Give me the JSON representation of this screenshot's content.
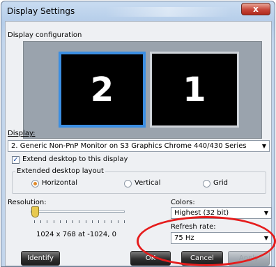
{
  "window": {
    "title": "Display Settings",
    "close_glyph": "x"
  },
  "config": {
    "section_label": "Display configuration",
    "monitors": [
      {
        "number": "2"
      },
      {
        "number": "1"
      }
    ]
  },
  "display": {
    "label": "Display:",
    "value": "2. Generic Non-PnP Monitor on S3 Graphics Chrome 440/430 Series"
  },
  "extend": {
    "label": "Extend desktop to this display",
    "checked": true
  },
  "layout": {
    "label": "Extended desktop layout",
    "options": [
      "Horizontal",
      "Vertical",
      "Grid"
    ],
    "selected": "Horizontal"
  },
  "resolution": {
    "label": "Resolution:",
    "value_text": "1024 x 768 at -1024, 0",
    "slider_level": 0
  },
  "colors": {
    "label": "Colors:",
    "value": "Highest (32 bit)"
  },
  "refresh": {
    "label": "Refresh rate:",
    "value": "75 Hz"
  },
  "buttons": {
    "identify": "Identify",
    "ok": "OK",
    "cancel": "Cancel",
    "apply": "Apply"
  },
  "highlight": {
    "color": "#e51c1c"
  }
}
